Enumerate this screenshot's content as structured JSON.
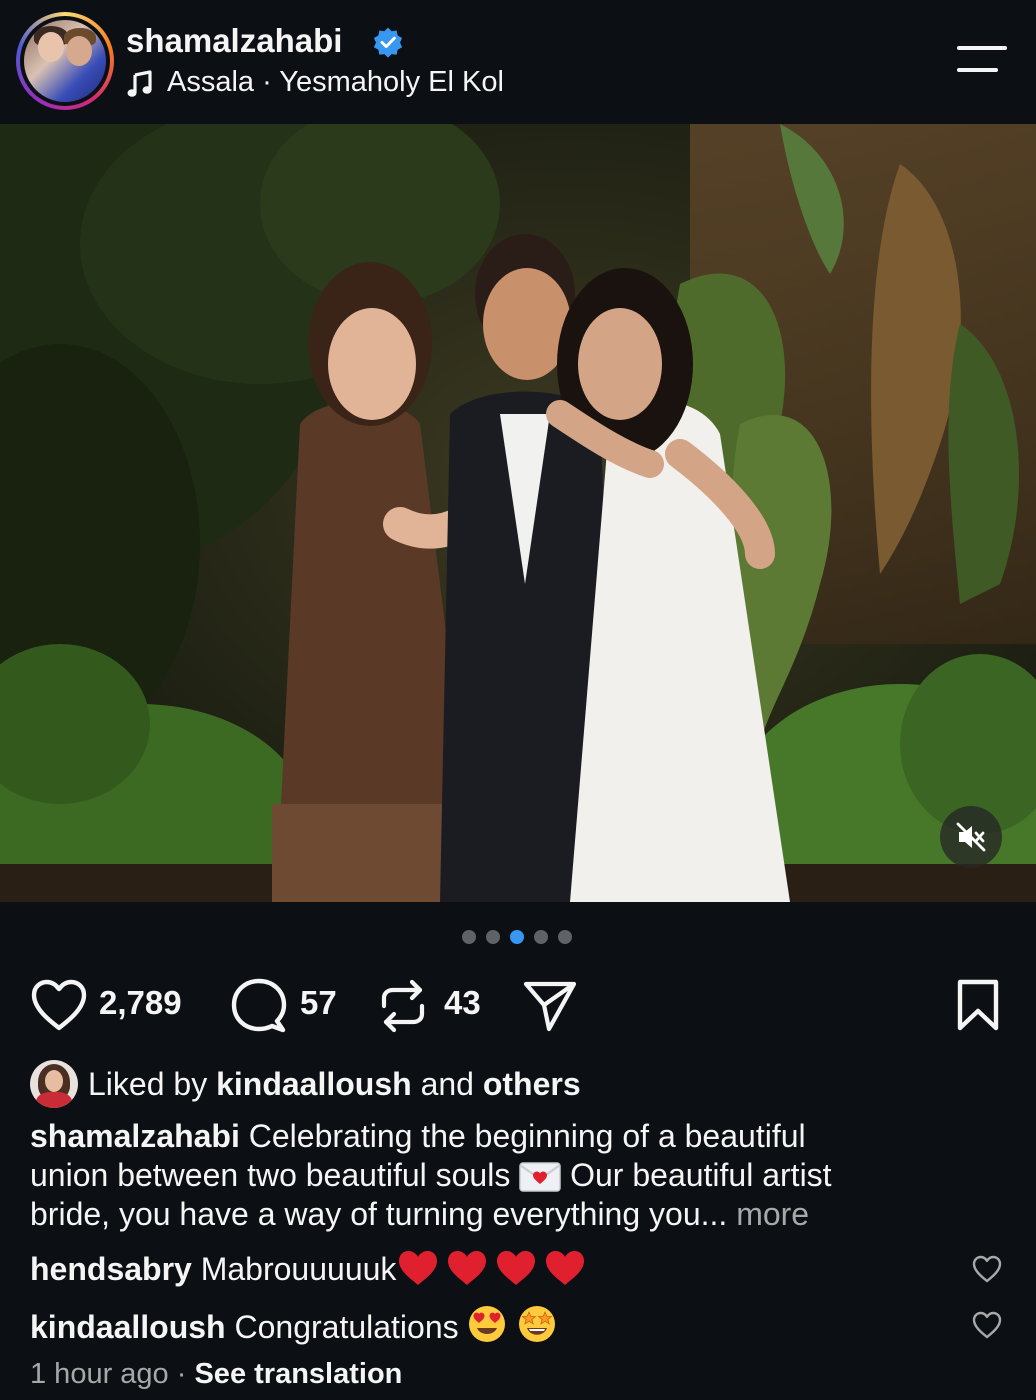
{
  "header": {
    "username": "shamalzahabi",
    "verified_icon": "verified-badge-icon",
    "music": {
      "icon": "music-note-icon",
      "text": "Assala · Yesmaholy El Kol"
    },
    "menu_icon": "hamburger-menu-icon"
  },
  "media": {
    "description_icon": "photo",
    "mute_icon": "muted-speaker-icon",
    "carousel_total": 5,
    "carousel_active_index": 2
  },
  "actions": {
    "like_count": "2,789",
    "comment_count": "57",
    "repost_count": "43",
    "icons": [
      "heart-icon",
      "comment-icon",
      "repost-icon",
      "share-icon",
      "bookmark-icon"
    ]
  },
  "likes": {
    "prefix": "Liked by ",
    "user": "kindaalloush",
    "middle": " and ",
    "suffix": "others"
  },
  "caption": {
    "username": "shamalzahabi",
    "line1": " Celebrating the beginning of a beautiful",
    "line2_a": "union between two beautiful souls ",
    "line2_b": " Our beautiful artist",
    "line3": "bride, you have a way of turning everything you... ",
    "more": "more",
    "emoji_icon": "love-letter-emoji"
  },
  "comments": [
    {
      "username": "hendsabry",
      "text": " Mabrouuuuuk",
      "emojis": [
        "red-heart-emoji",
        "red-heart-emoji",
        "red-heart-emoji",
        "red-heart-emoji"
      ]
    },
    {
      "username": "kindaalloush",
      "text": " Congratulations ",
      "emojis": [
        "heart-eyes-emoji",
        "star-struck-emoji"
      ]
    }
  ],
  "footer": {
    "time": "1 hour ago",
    "separator": "·",
    "translate": "See translation"
  },
  "colors": {
    "background": "#0c1014",
    "text": "#f5f5f5",
    "muted": "#a8a8a8",
    "accent": "#3897f0",
    "heart_red": "#e0202f"
  }
}
